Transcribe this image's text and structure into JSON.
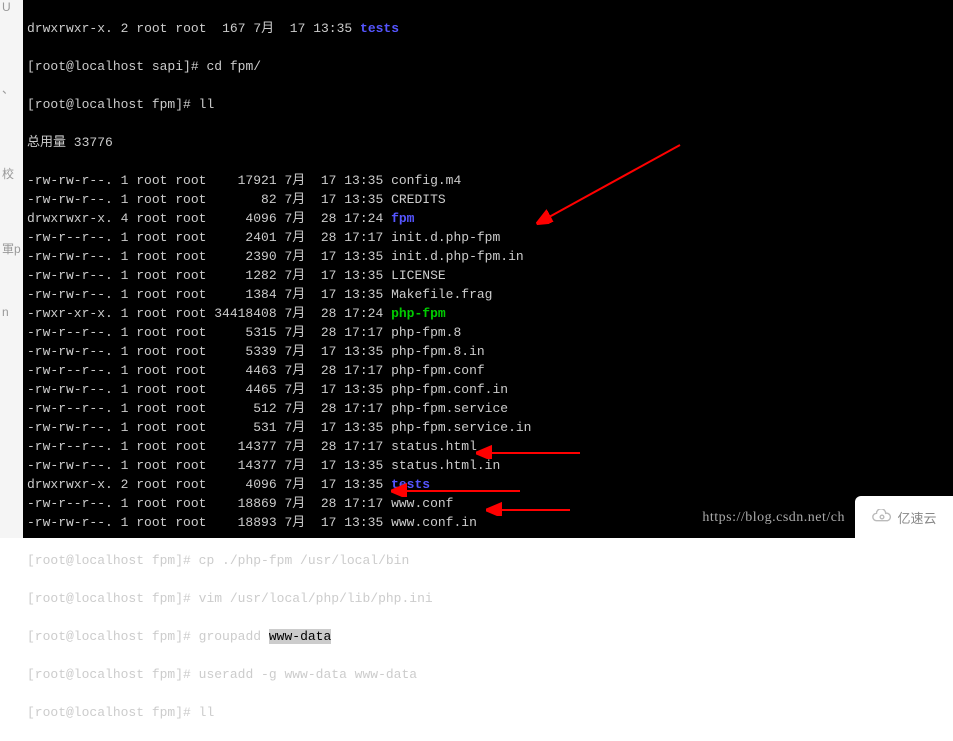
{
  "sidebar": {
    "items": [
      "U",
      "、",
      "校",
      "軍p",
      "n"
    ]
  },
  "listing": [
    {
      "perm": "drwxrwxr-x.",
      "links": "2",
      "owner": "root",
      "group": "root",
      "size": "  167",
      "month": "7月",
      "day": "17",
      "time": "13:35",
      "name": "tests",
      "type": "dir"
    }
  ],
  "prompts": {
    "p1": "[root@localhost sapi]# ",
    "p2": "[root@localhost fpm]# ",
    "cmd_cd": "cd fpm/",
    "cmd_ll": "ll",
    "total": "总用量 33776"
  },
  "files": [
    {
      "perm": "-rw-rw-r--.",
      "links": "1",
      "owner": "root",
      "group": "root",
      "size": "   17921",
      "month": "7月",
      "day": "17",
      "time": "13:35",
      "name": "config.m4",
      "type": "file"
    },
    {
      "perm": "-rw-rw-r--.",
      "links": "1",
      "owner": "root",
      "group": "root",
      "size": "      82",
      "month": "7月",
      "day": "17",
      "time": "13:35",
      "name": "CREDITS",
      "type": "file"
    },
    {
      "perm": "drwxrwxr-x.",
      "links": "4",
      "owner": "root",
      "group": "root",
      "size": "    4096",
      "month": "7月",
      "day": "28",
      "time": "17:24",
      "name": "fpm",
      "type": "dir"
    },
    {
      "perm": "-rw-r--r--.",
      "links": "1",
      "owner": "root",
      "group": "root",
      "size": "    2401",
      "month": "7月",
      "day": "28",
      "time": "17:17",
      "name": "init.d.php-fpm",
      "type": "file"
    },
    {
      "perm": "-rw-rw-r--.",
      "links": "1",
      "owner": "root",
      "group": "root",
      "size": "    2390",
      "month": "7月",
      "day": "17",
      "time": "13:35",
      "name": "init.d.php-fpm.in",
      "type": "file"
    },
    {
      "perm": "-rw-rw-r--.",
      "links": "1",
      "owner": "root",
      "group": "root",
      "size": "    1282",
      "month": "7月",
      "day": "17",
      "time": "13:35",
      "name": "LICENSE",
      "type": "file"
    },
    {
      "perm": "-rw-rw-r--.",
      "links": "1",
      "owner": "root",
      "group": "root",
      "size": "    1384",
      "month": "7月",
      "day": "17",
      "time": "13:35",
      "name": "Makefile.frag",
      "type": "file"
    },
    {
      "perm": "-rwxr-xr-x.",
      "links": "1",
      "owner": "root",
      "group": "root",
      "size": "34418408",
      "month": "7月",
      "day": "28",
      "time": "17:24",
      "name": "php-fpm",
      "type": "exe"
    },
    {
      "perm": "-rw-r--r--.",
      "links": "1",
      "owner": "root",
      "group": "root",
      "size": "    5315",
      "month": "7月",
      "day": "28",
      "time": "17:17",
      "name": "php-fpm.8",
      "type": "file"
    },
    {
      "perm": "-rw-rw-r--.",
      "links": "1",
      "owner": "root",
      "group": "root",
      "size": "    5339",
      "month": "7月",
      "day": "17",
      "time": "13:35",
      "name": "php-fpm.8.in",
      "type": "file"
    },
    {
      "perm": "-rw-r--r--.",
      "links": "1",
      "owner": "root",
      "group": "root",
      "size": "    4463",
      "month": "7月",
      "day": "28",
      "time": "17:17",
      "name": "php-fpm.conf",
      "type": "file"
    },
    {
      "perm": "-rw-rw-r--.",
      "links": "1",
      "owner": "root",
      "group": "root",
      "size": "    4465",
      "month": "7月",
      "day": "17",
      "time": "13:35",
      "name": "php-fpm.conf.in",
      "type": "file"
    },
    {
      "perm": "-rw-r--r--.",
      "links": "1",
      "owner": "root",
      "group": "root",
      "size": "     512",
      "month": "7月",
      "day": "28",
      "time": "17:17",
      "name": "php-fpm.service",
      "type": "file"
    },
    {
      "perm": "-rw-rw-r--.",
      "links": "1",
      "owner": "root",
      "group": "root",
      "size": "     531",
      "month": "7月",
      "day": "17",
      "time": "13:35",
      "name": "php-fpm.service.in",
      "type": "file"
    },
    {
      "perm": "-rw-r--r--.",
      "links": "1",
      "owner": "root",
      "group": "root",
      "size": "   14377",
      "month": "7月",
      "day": "28",
      "time": "17:17",
      "name": "status.html",
      "type": "file"
    },
    {
      "perm": "-rw-rw-r--.",
      "links": "1",
      "owner": "root",
      "group": "root",
      "size": "   14377",
      "month": "7月",
      "day": "17",
      "time": "13:35",
      "name": "status.html.in",
      "type": "file"
    },
    {
      "perm": "drwxrwxr-x.",
      "links": "2",
      "owner": "root",
      "group": "root",
      "size": "    4096",
      "month": "7月",
      "day": "17",
      "time": "13:35",
      "name": "tests",
      "type": "dir"
    },
    {
      "perm": "-rw-r--r--.",
      "links": "1",
      "owner": "root",
      "group": "root",
      "size": "   18869",
      "month": "7月",
      "day": "28",
      "time": "17:17",
      "name": "www.conf",
      "type": "file"
    },
    {
      "perm": "-rw-rw-r--.",
      "links": "1",
      "owner": "root",
      "group": "root",
      "size": "   18893",
      "month": "7月",
      "day": "17",
      "time": "13:35",
      "name": "www.conf.in",
      "type": "file"
    }
  ],
  "commands": {
    "cp": "cp ./php-fpm /usr/local/bin",
    "vim": "vim /usr/local/php/lib/php.ini",
    "groupadd_pre": "groupadd ",
    "groupadd_arg": "www-data",
    "useradd": "useradd -g www-data www-data"
  },
  "watermark": "https://blog.csdn.net/ch",
  "logo": "亿速云"
}
